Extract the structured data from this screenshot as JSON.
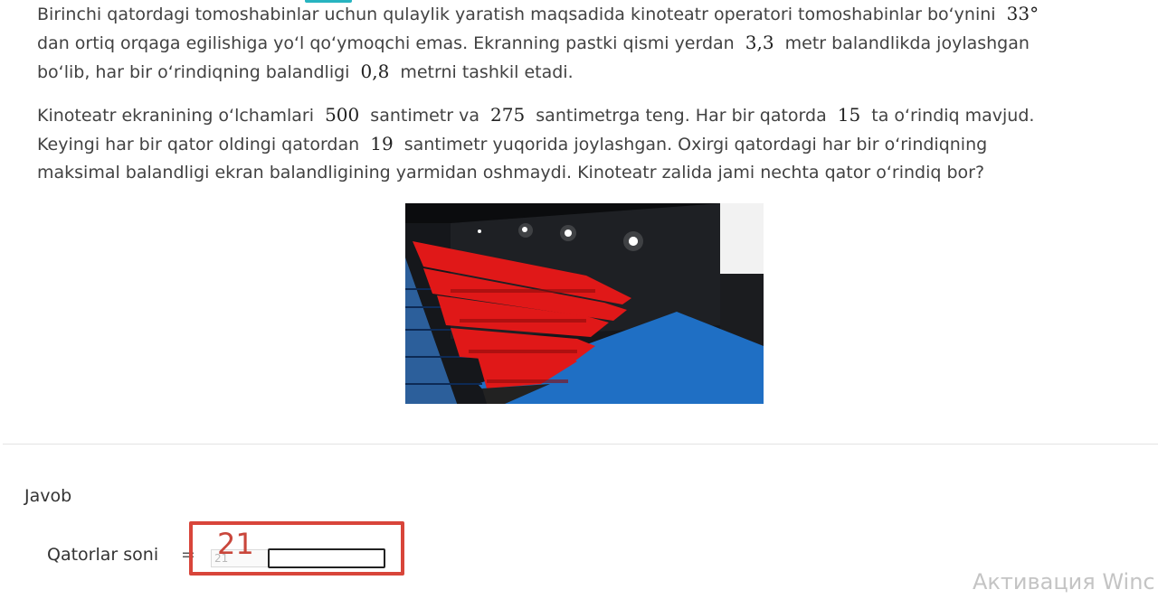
{
  "problem": {
    "p1": {
      "l1_a": "Birinchi qatordagi tomoshabinlar uchun qulaylik yaratish maqsadida kinoteatr operatori tomoshabinlar bo‘ynini",
      "l1_m": "33°",
      "l2_a": "dan ortiq orqaga egilishiga yo‘l qo‘ymoqchi emas. Ekranning pastki qismi yerdan",
      "l2_m": "3,3",
      "l2_b": "metr balandlikda joylashgan",
      "l3_a": "bo‘lib, har bir o‘rindiqning balandligi",
      "l3_m": "0,8",
      "l3_b": "metrni tashkil etadi."
    },
    "p2": {
      "l1_a": "Kinoteatr ekranining o‘lchamlari",
      "l1_m1": "500",
      "l1_b": "santimetr va",
      "l1_m2": "275",
      "l1_c": "santimetrga teng. Har bir qatorda",
      "l1_m3": "15",
      "l1_d": "ta o‘rindiq mavjud.",
      "l2_a": "Keyingi har bir qator oldingi qatordan",
      "l2_m": "19",
      "l2_b": "santimetr yuqorida joylashgan. Oxirgi qatordagi har bir o‘rindiqning",
      "l3_a": "maksimal balandligi ekran balandligining yarmidan oshmaydi. Kinoteatr zalida jami nechta qator o‘rindiq bor?"
    }
  },
  "answer": {
    "heading": "Javob",
    "label": "Qatorlar soni",
    "equals": "=",
    "small_value": "21",
    "handwritten_value": "21",
    "input_value": ""
  },
  "watermark": "Активация Winc",
  "colors": {
    "accent": "#27b4c0",
    "highlight": "#d8453a",
    "seat_red": "#e01818",
    "floor_blue": "#1f6fc4"
  }
}
